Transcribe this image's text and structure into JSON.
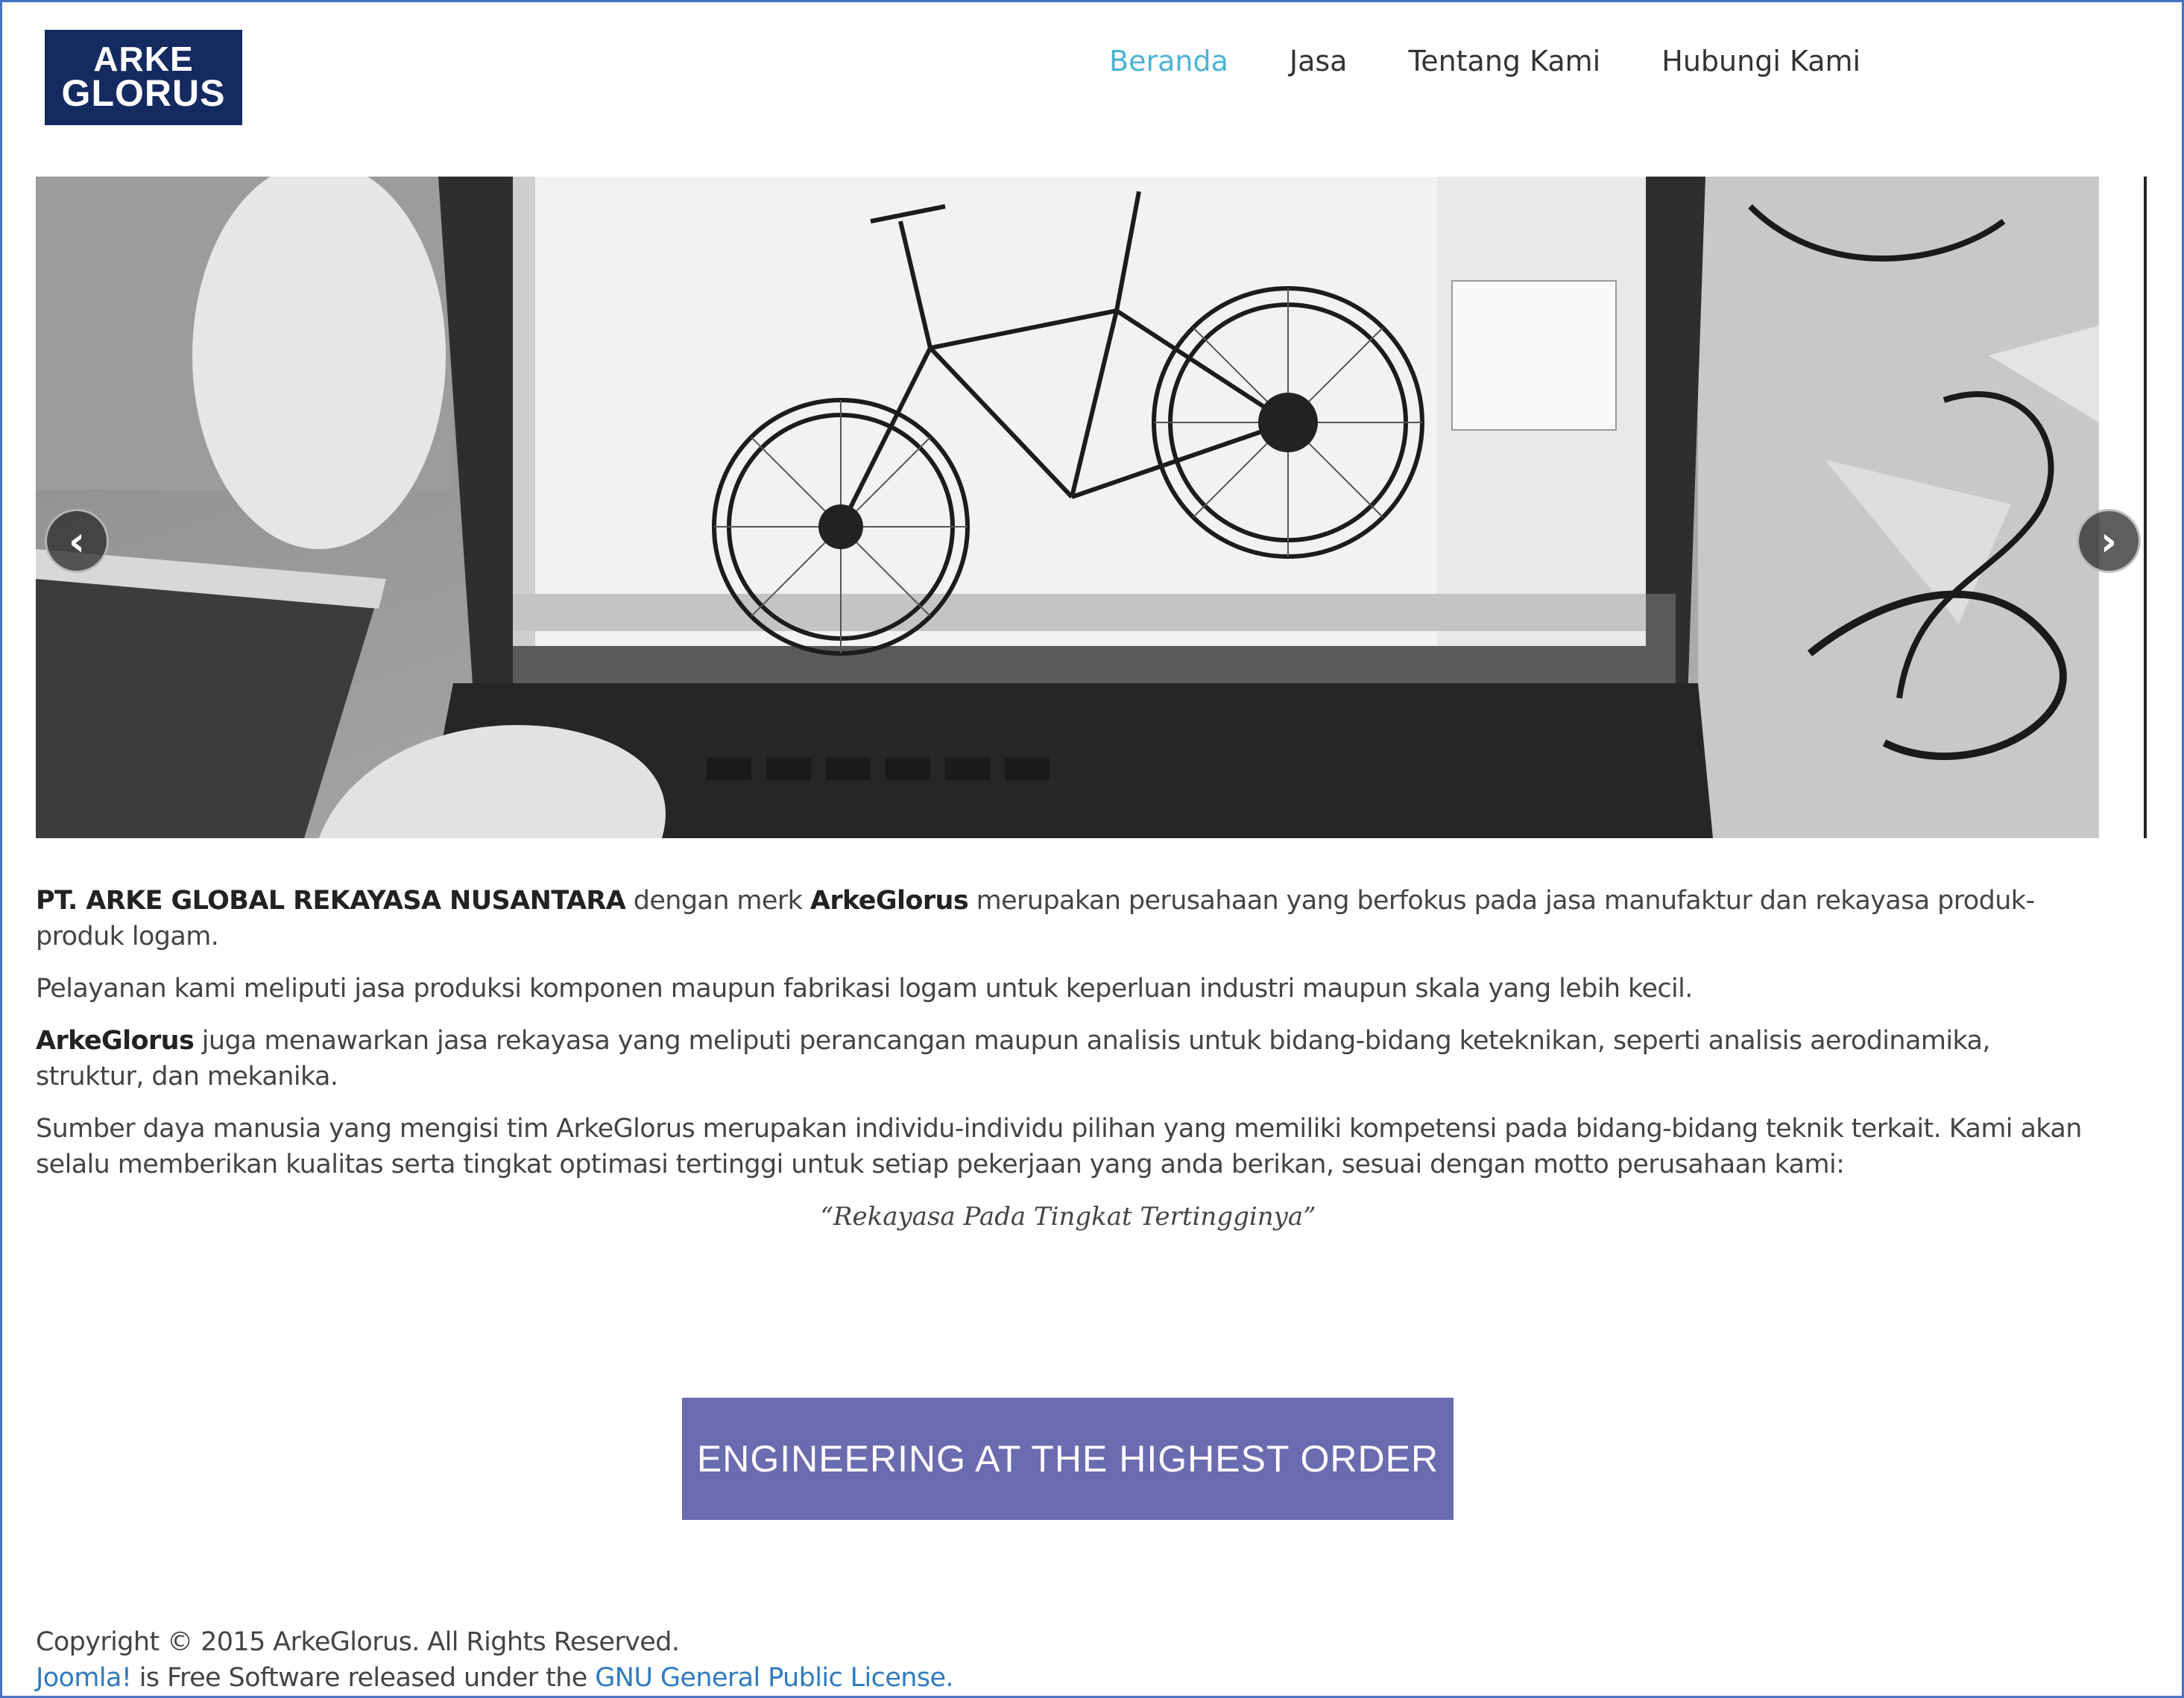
{
  "header": {
    "logo_line1": "ARKE",
    "logo_line2": "GLORUS",
    "nav": [
      {
        "label": "Beranda",
        "active": true
      },
      {
        "label": "Jasa",
        "active": false
      },
      {
        "label": "Tentang Kami",
        "active": false
      },
      {
        "label": "Hubungi Kami",
        "active": false
      }
    ]
  },
  "carousel": {
    "image": "laptop-showing-bicycle-cad-model",
    "prev_icon": "chevron-left-icon",
    "next_icon": "chevron-right-icon",
    "prev_glyph": "‹",
    "next_glyph": "›"
  },
  "content": {
    "p1_bold1": "PT. ARKE GLOBAL REKAYASA NUSANTARA",
    "p1_text1": " dengan merk ",
    "p1_bold2": "ArkeGlorus",
    "p1_text2": " merupakan perusahaan yang berfokus pada jasa manufaktur dan rekayasa produk-produk logam.",
    "p2": "Pelayanan kami meliputi jasa produksi komponen maupun fabrikasi logam untuk keperluan industri maupun skala yang lebih kecil.",
    "p3_bold": "ArkeGlorus",
    "p3_text": " juga menawarkan jasa rekayasa yang meliputi perancangan maupun analisis untuk bidang-bidang keteknikan, seperti analisis aerodinamika, struktur, dan mekanika.",
    "p4": "Sumber daya manusia yang mengisi tim ArkeGlorus merupakan individu-individu pilihan yang memiliki kompetensi pada bidang-bidang teknik terkait. Kami akan selalu memberikan kualitas serta tingkat optimasi tertinggi untuk setiap pekerjaan yang anda berikan, sesuai dengan motto perusahaan kami:",
    "motto": "“Rekayasa Pada Tingkat Tertingginya”"
  },
  "banner": {
    "text": "ENGINEERING AT THE HIGHEST ORDER",
    "color": "#6b6bb0"
  },
  "footer": {
    "copyright": "Copyright © 2015 ArkeGlorus. All Rights Reserved.",
    "joomla_link": "Joomla!",
    "line2_text": " is Free Software released under the ",
    "license_link": "GNU General Public License."
  },
  "colors": {
    "nav_active": "#4db3d4",
    "logo_bg": "#142a61",
    "link": "#2f7bc0"
  }
}
